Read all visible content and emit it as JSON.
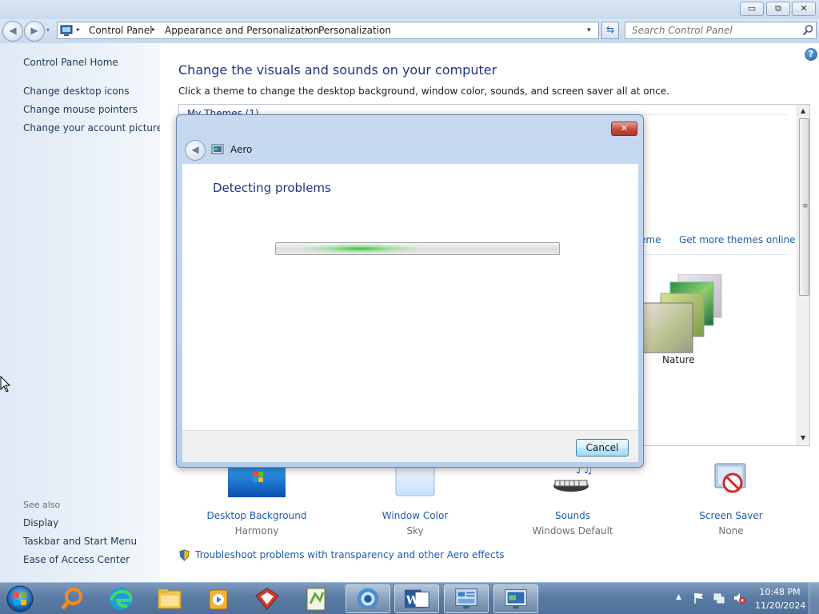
{
  "window": {
    "min_glyph": "▭",
    "max_glyph": "⧉",
    "close_glyph": "✕"
  },
  "navigation": {
    "back_glyph": "◀",
    "forward_glyph": "▶",
    "dropdown_glyph": "▾",
    "breadcrumb": [
      "Control Panel",
      "Appearance and Personalization",
      "Personalization"
    ],
    "separator_glyph": "▸",
    "address_dropdown_glyph": "▾",
    "refresh_glyph": "⇆",
    "search_placeholder": "Search Control Panel"
  },
  "sidebar": {
    "home": "Control Panel Home",
    "links": [
      "Change desktop icons",
      "Change mouse pointers",
      "Change your account picture"
    ],
    "see_also_label": "See also",
    "see_also": [
      "Display",
      "Taskbar and Start Menu",
      "Ease of Access Center"
    ]
  },
  "main": {
    "title": "Change the visuals and sounds on your computer",
    "description": "Click a theme to change the desktop background, window color, sounds, and screen saver all at once.",
    "help_glyph": "?",
    "themes": {
      "group_header": "My Themes (1)",
      "save_theme_link": "eme",
      "get_more_link": "Get more themes online",
      "nature_label": "Nature",
      "scroll_up": "▲",
      "scroll_down": "▼",
      "scroll_grip": "≡"
    },
    "bottom": [
      {
        "label": "Desktop Background",
        "value": "Harmony"
      },
      {
        "label": "Window Color",
        "value": "Sky"
      },
      {
        "label": "Sounds",
        "value": "Windows Default"
      },
      {
        "label": "Screen Saver",
        "value": "None"
      }
    ],
    "troubleshoot_link": "Troubleshoot problems with transparency and other Aero effects"
  },
  "dialog": {
    "close_glyph": "✕",
    "back_glyph": "◀",
    "title": "Aero",
    "heading": "Detecting problems",
    "progress_state": "indeterminate",
    "cancel_label": "Cancel"
  },
  "taskbar": {
    "pinned": [
      "start-orb",
      "search-everything",
      "edge",
      "file-explorer",
      "media-player",
      "cad-app",
      "notepad-plus",
      "chrome",
      "word",
      "control-panel",
      "personalization"
    ],
    "tray_chevron": "▲",
    "time": "10:48 PM",
    "date": "11/20/2024"
  },
  "colors": {
    "link": "#1e5cab",
    "title": "#1e3287",
    "taskbar": "#5a7ca4",
    "progress_glow": "#24c824"
  }
}
